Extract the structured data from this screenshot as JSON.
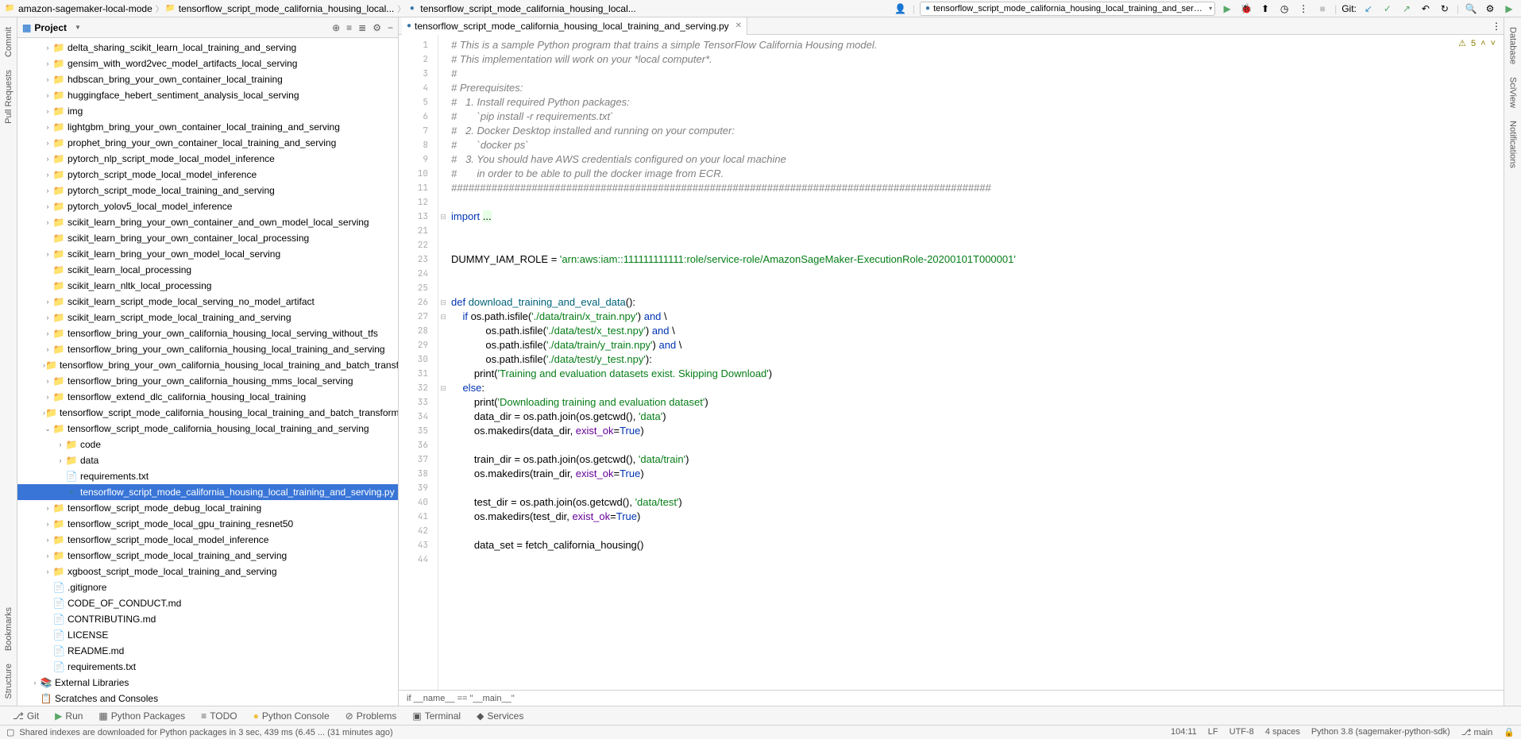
{
  "breadcrumb": {
    "root": "amazon-sagemaker-local-mode",
    "mid": "tensorflow_script_mode_california_housing_local...",
    "file": "tensorflow_script_mode_california_housing_local..."
  },
  "runconfig": "tensorflow_script_mode_california_housing_local_training_and_serving",
  "git_label": "Git:",
  "panel": {
    "title": "Project"
  },
  "tab": {
    "name": "tensorflow_script_mode_california_housing_local_training_and_serving.py"
  },
  "analysis": {
    "count": "5"
  },
  "tree": [
    {
      "d": 2,
      "a": "r",
      "i": "dir",
      "l": "delta_sharing_scikit_learn_local_training_and_serving"
    },
    {
      "d": 2,
      "a": "r",
      "i": "dir",
      "l": "gensim_with_word2vec_model_artifacts_local_serving"
    },
    {
      "d": 2,
      "a": "r",
      "i": "dir",
      "l": "hdbscan_bring_your_own_container_local_training"
    },
    {
      "d": 2,
      "a": "r",
      "i": "dir",
      "l": "huggingface_hebert_sentiment_analysis_local_serving"
    },
    {
      "d": 2,
      "a": "r",
      "i": "dir",
      "l": "img"
    },
    {
      "d": 2,
      "a": "r",
      "i": "dir",
      "l": "lightgbm_bring_your_own_container_local_training_and_serving"
    },
    {
      "d": 2,
      "a": "r",
      "i": "dir",
      "l": "prophet_bring_your_own_container_local_training_and_serving"
    },
    {
      "d": 2,
      "a": "r",
      "i": "dir",
      "l": "pytorch_nlp_script_mode_local_model_inference"
    },
    {
      "d": 2,
      "a": "r",
      "i": "dir",
      "l": "pytorch_script_mode_local_model_inference"
    },
    {
      "d": 2,
      "a": "r",
      "i": "dir",
      "l": "pytorch_script_mode_local_training_and_serving"
    },
    {
      "d": 2,
      "a": "r",
      "i": "dir",
      "l": "pytorch_yolov5_local_model_inference"
    },
    {
      "d": 2,
      "a": "r",
      "i": "dir",
      "l": "scikit_learn_bring_your_own_container_and_own_model_local_serving"
    },
    {
      "d": 2,
      "a": "",
      "i": "dir",
      "l": "scikit_learn_bring_your_own_container_local_processing"
    },
    {
      "d": 2,
      "a": "r",
      "i": "dir",
      "l": "scikit_learn_bring_your_own_model_local_serving"
    },
    {
      "d": 2,
      "a": "",
      "i": "dir",
      "l": "scikit_learn_local_processing"
    },
    {
      "d": 2,
      "a": "",
      "i": "dir",
      "l": "scikit_learn_nltk_local_processing"
    },
    {
      "d": 2,
      "a": "r",
      "i": "dir",
      "l": "scikit_learn_script_mode_local_serving_no_model_artifact"
    },
    {
      "d": 2,
      "a": "r",
      "i": "dir",
      "l": "scikit_learn_script_mode_local_training_and_serving"
    },
    {
      "d": 2,
      "a": "r",
      "i": "dir",
      "l": "tensorflow_bring_your_own_california_housing_local_serving_without_tfs"
    },
    {
      "d": 2,
      "a": "r",
      "i": "dir",
      "l": "tensorflow_bring_your_own_california_housing_local_training_and_serving"
    },
    {
      "d": 2,
      "a": "r",
      "i": "dir",
      "l": "tensorflow_bring_your_own_california_housing_local_training_and_batch_transform"
    },
    {
      "d": 2,
      "a": "r",
      "i": "dir",
      "l": "tensorflow_bring_your_own_california_housing_mms_local_serving"
    },
    {
      "d": 2,
      "a": "r",
      "i": "dir",
      "l": "tensorflow_extend_dlc_california_housing_local_training"
    },
    {
      "d": 2,
      "a": "r",
      "i": "dir",
      "l": "tensorflow_script_mode_california_housing_local_training_and_batch_transform"
    },
    {
      "d": 2,
      "a": "d",
      "i": "dir",
      "l": "tensorflow_script_mode_california_housing_local_training_and_serving"
    },
    {
      "d": 3,
      "a": "r",
      "i": "dir",
      "l": "code"
    },
    {
      "d": 3,
      "a": "r",
      "i": "dir",
      "l": "data"
    },
    {
      "d": 3,
      "a": "",
      "i": "txt",
      "l": "requirements.txt"
    },
    {
      "d": 3,
      "a": "",
      "i": "py",
      "l": "tensorflow_script_mode_california_housing_local_training_and_serving.py",
      "sel": true
    },
    {
      "d": 2,
      "a": "r",
      "i": "dir",
      "l": "tensorflow_script_mode_debug_local_training"
    },
    {
      "d": 2,
      "a": "r",
      "i": "dir",
      "l": "tensorflow_script_mode_local_gpu_training_resnet50"
    },
    {
      "d": 2,
      "a": "r",
      "i": "dir",
      "l": "tensorflow_script_mode_local_model_inference"
    },
    {
      "d": 2,
      "a": "r",
      "i": "dir",
      "l": "tensorflow_script_mode_local_training_and_serving"
    },
    {
      "d": 2,
      "a": "r",
      "i": "dir",
      "l": "xgboost_script_mode_local_training_and_serving"
    },
    {
      "d": 2,
      "a": "",
      "i": "txt",
      "l": ".gitignore"
    },
    {
      "d": 2,
      "a": "",
      "i": "md",
      "l": "CODE_OF_CONDUCT.md"
    },
    {
      "d": 2,
      "a": "",
      "i": "md",
      "l": "CONTRIBUTING.md"
    },
    {
      "d": 2,
      "a": "",
      "i": "txt",
      "l": "LICENSE"
    },
    {
      "d": 2,
      "a": "",
      "i": "md",
      "l": "README.md"
    },
    {
      "d": 2,
      "a": "",
      "i": "txt",
      "l": "requirements.txt"
    },
    {
      "d": 1,
      "a": "r",
      "i": "lib",
      "l": "External Libraries"
    },
    {
      "d": 1,
      "a": "",
      "i": "scr",
      "l": "Scratches and Consoles"
    }
  ],
  "lines": [
    1,
    2,
    3,
    4,
    5,
    6,
    7,
    8,
    9,
    10,
    11,
    12,
    13,
    21,
    22,
    23,
    24,
    25,
    26,
    27,
    28,
    29,
    30,
    31,
    32,
    33,
    34,
    35,
    36,
    37,
    38,
    39,
    40,
    41,
    42,
    43,
    44
  ],
  "code": {
    "l1": "# This is a sample Python program that trains a simple TensorFlow California Housing model.",
    "l2": "# This implementation will work on your *local computer*.",
    "l3": "#",
    "l4": "# Prerequisites:",
    "l5": "#   1. Install required Python packages:",
    "l6": "#       `pip install -r requirements.txt`",
    "l7": "#   2. Docker Desktop installed and running on your computer:",
    "l8": "#       `docker ps`",
    "l9": "#   3. You should have AWS credentials configured on your local machine",
    "l10": "#       in order to be able to pull the docker image from ECR.",
    "l11": "##############################################################################################",
    "iam": "'arn:aws:iam::111111111111:role/service-role/AmazonSageMaker-ExecutionRole-20200101T000001'",
    "tr": "'./data/train/x_train.npy'",
    "te": "'./data/test/x_test.npy'",
    "trY": "'./data/train/y_train.npy'",
    "teY": "'./data/test/y_test.npy'",
    "prskip": "'Training and evaluation datasets exist. Skipping Download'",
    "prdl": "'Downloading training and evaluation dataset'",
    "sdata": "'data'",
    "sdtrain": "'data/train'",
    "sdtest": "'data/test'"
  },
  "code_footer": "if __name__ == \"__main__\"",
  "bottom": {
    "git": "Git",
    "run": "Run",
    "pkg": "Python Packages",
    "todo": "TODO",
    "pyconsole": "Python Console",
    "problems": "Problems",
    "terminal": "Terminal",
    "services": "Services"
  },
  "status": {
    "left": "Shared indexes are downloaded for Python packages in 3 sec, 439 ms (6.45 ... (31 minutes ago)",
    "pos": "104:11",
    "le": "LF",
    "enc": "UTF-8",
    "ind": "4 spaces",
    "py": "Python 3.8 (sagemaker-python-sdk)",
    "branch": "main"
  },
  "stripes": {
    "left": [
      "Commit",
      "Pull Requests",
      "Bookmarks",
      "Structure"
    ],
    "right": [
      "Database",
      "SciView",
      "Notifications"
    ]
  }
}
